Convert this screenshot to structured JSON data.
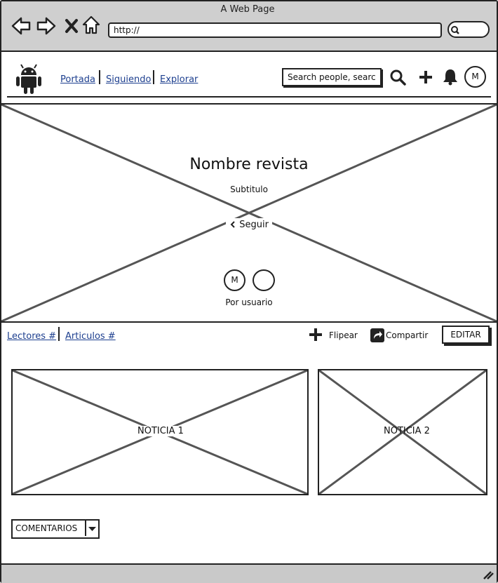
{
  "window": {
    "title": "A Web Page",
    "url": "http://"
  },
  "browser_icons": [
    "back-arrow-icon",
    "forward-arrow-icon",
    "close-x-icon",
    "home-icon",
    "search-icon"
  ],
  "nav": {
    "logo": "android-icon",
    "links": [
      "Portada",
      "Siguiendo",
      "Explorar"
    ],
    "search_placeholder": "Search people, searc",
    "avatar_initial": "M"
  },
  "hero": {
    "title": "Nombre revista",
    "subtitle": "Subtitulo",
    "follow_label": "Seguir",
    "avatar_initial": "M",
    "by_label": "Por usuario"
  },
  "toolbar": {
    "readers": "Lectores #",
    "articles": "Articulos #",
    "flip": "Flipear",
    "share": "Compartir",
    "edit": "EDITAR"
  },
  "cards": [
    {
      "label": "NOTICIA 1"
    },
    {
      "label": "NOTICIA 2"
    }
  ],
  "comments": {
    "label": "COMENTARIOS"
  }
}
